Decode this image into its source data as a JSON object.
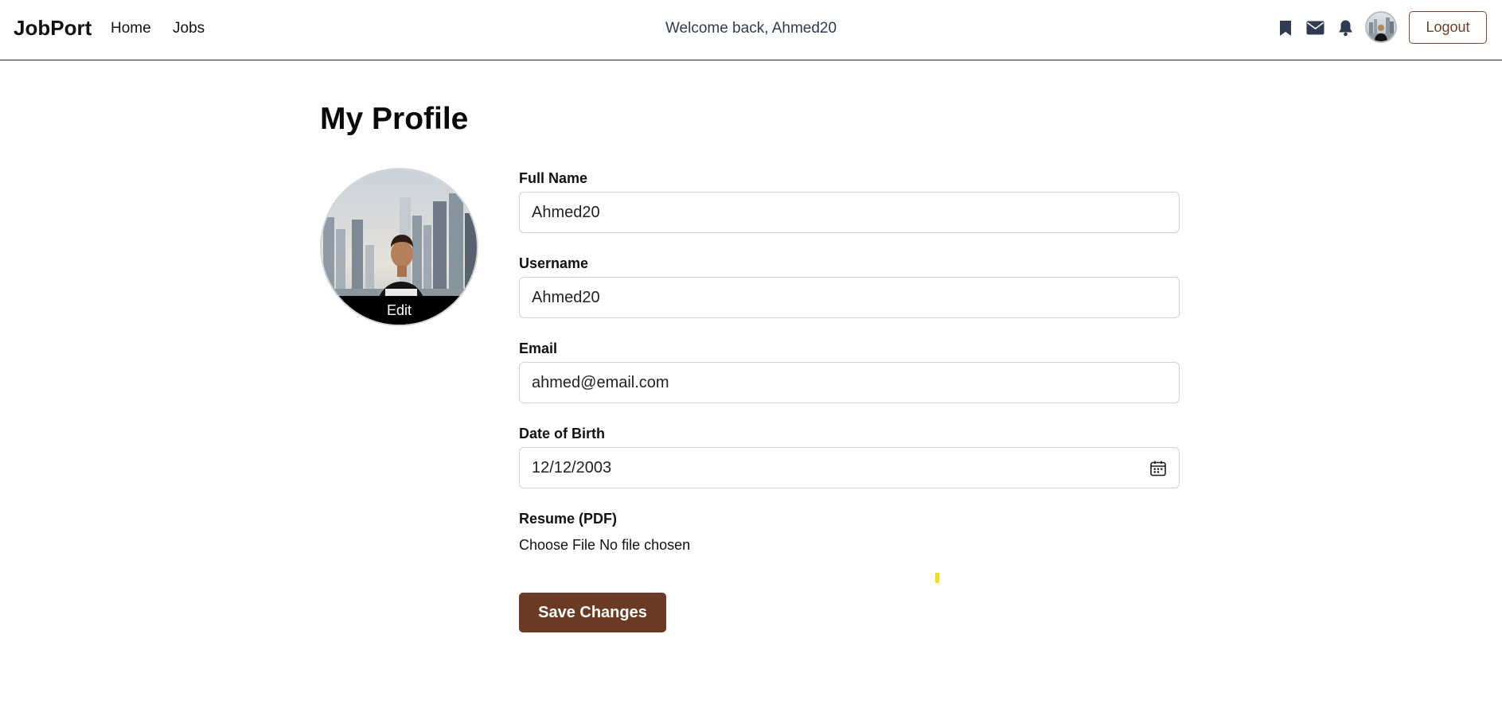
{
  "navbar": {
    "brand": "JobPort",
    "links": [
      {
        "label": "Home"
      },
      {
        "label": "Jobs"
      }
    ],
    "welcome": "Welcome back, Ahmed20",
    "icons": [
      "bookmark-icon",
      "mail-icon",
      "bell-icon"
    ],
    "logout_label": "Logout"
  },
  "page": {
    "title": "My Profile"
  },
  "profile_picture": {
    "edit_label": "Edit"
  },
  "form": {
    "full_name": {
      "label": "Full Name",
      "value": "Ahmed20"
    },
    "username": {
      "label": "Username",
      "value": "Ahmed20"
    },
    "email": {
      "label": "Email",
      "value": "ahmed@email.com"
    },
    "dob": {
      "label": "Date of Birth",
      "value": "12/12/2003"
    },
    "resume": {
      "label": "Resume (PDF)",
      "button": "Choose File",
      "status": "No file chosen"
    },
    "submit_label": "Save Changes"
  },
  "colors": {
    "accent": "#6b3a22",
    "nav_text": "#2f3b52",
    "input_border": "#d2d2d2"
  }
}
